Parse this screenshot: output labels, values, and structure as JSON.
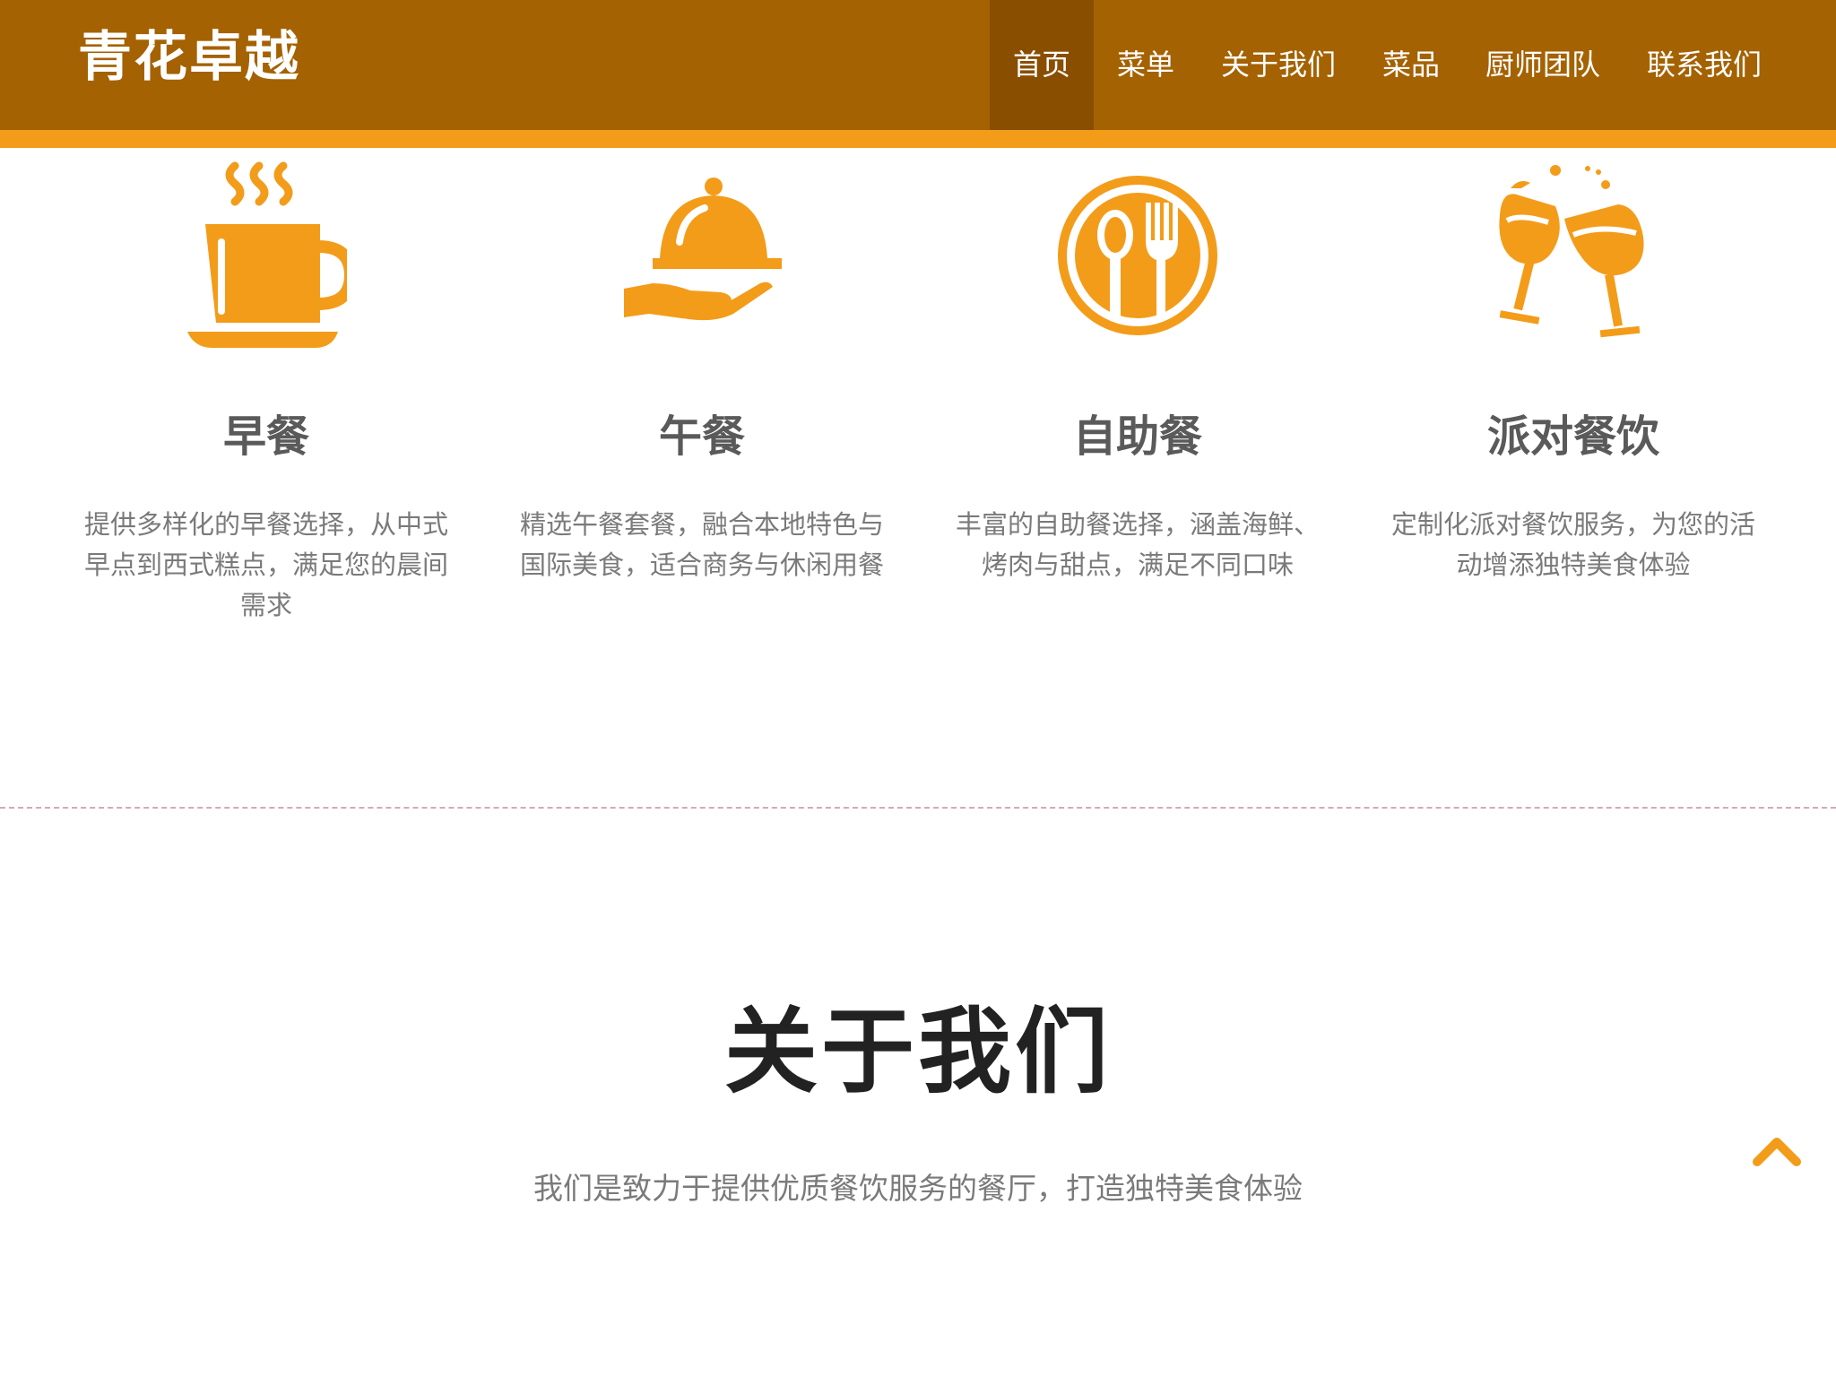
{
  "header": {
    "logo": "青花卓越",
    "nav": [
      "首页",
      "菜单",
      "关于我们",
      "菜品",
      "厨师团队",
      "联系我们"
    ],
    "active_index": 0
  },
  "features": [
    {
      "icon": "coffee-cup-icon",
      "title": "早餐",
      "desc": "提供多样化的早餐选择，从中式早点到西式糕点，满足您的晨间需求"
    },
    {
      "icon": "cloche-serving-icon",
      "title": "午餐",
      "desc": "精选午餐套餐，融合本地特色与国际美食，适合商务与休闲用餐"
    },
    {
      "icon": "spoon-fork-plate-icon",
      "title": "自助餐",
      "desc": "丰富的自助餐选择，涵盖海鲜、烤肉与甜点，满足不同口味"
    },
    {
      "icon": "wine-toast-icon",
      "title": "派对餐饮",
      "desc": "定制化派对餐饮服务，为您的活动增添独特美食体验"
    }
  ],
  "about": {
    "title": "关于我们",
    "desc": "我们是致力于提供优质餐饮服务的餐厅，打造独特美食体验"
  },
  "colors": {
    "header_bg": "#a46202",
    "accent": "#f39c1a",
    "active_nav": "#8a4e00"
  },
  "back_to_top_icon": "chevron-up-icon"
}
